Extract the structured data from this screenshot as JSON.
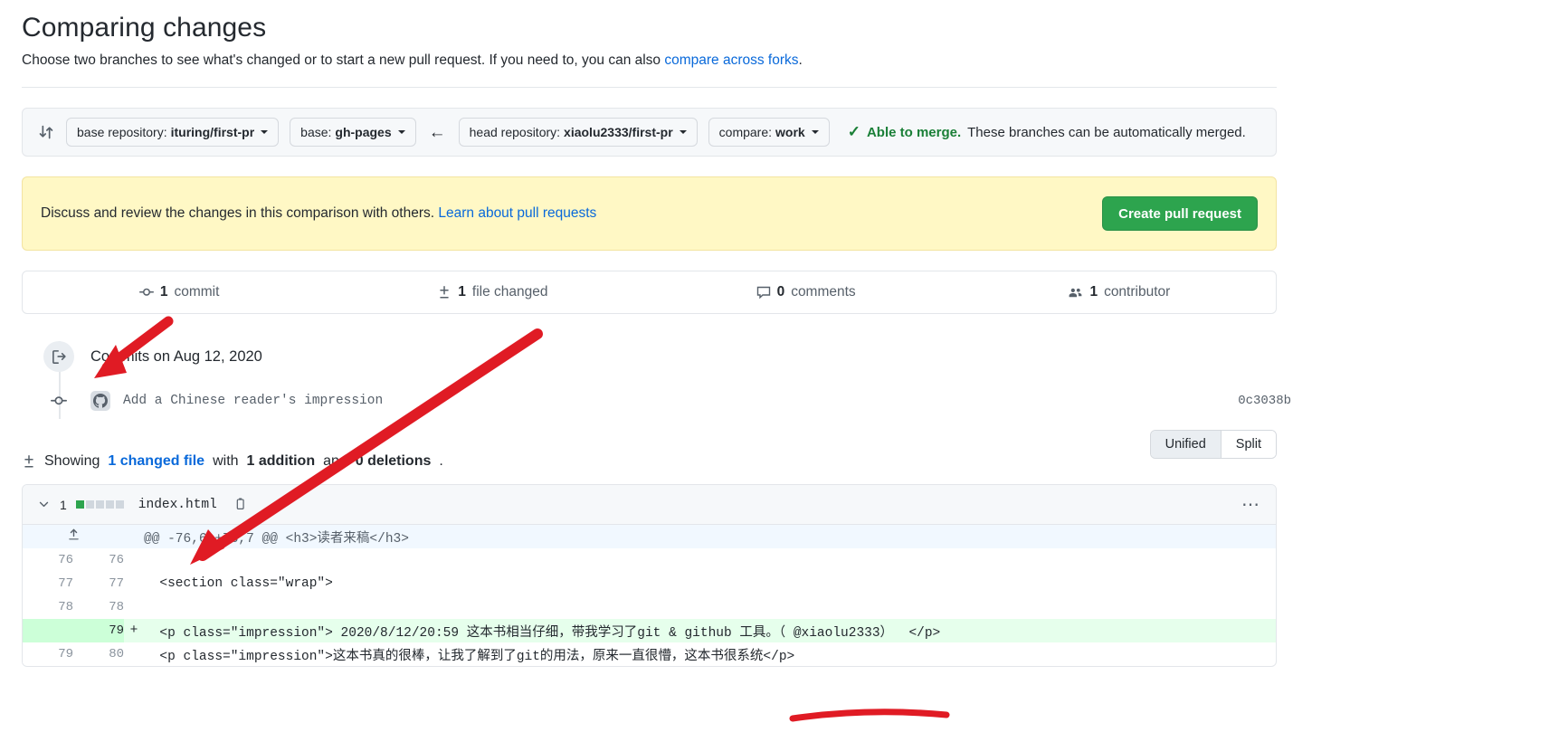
{
  "header": {
    "title": "Comparing changes",
    "subtitle_pre": "Choose two branches to see what's changed or to start a new pull request. If you need to, you can also ",
    "subtitle_link": "compare across forks",
    "subtitle_post": "."
  },
  "branch_bar": {
    "compare_icon": "compare-arrows-icon",
    "base_repository": {
      "label": "base repository:",
      "value": "ituring/first-pr"
    },
    "base": {
      "label": "base:",
      "value": "gh-pages"
    },
    "direction_arrow": "arrow-left-icon",
    "head_repository": {
      "label": "head repository:",
      "value": "xiaolu2333/first-pr"
    },
    "compare": {
      "label": "compare:",
      "value": "work"
    },
    "merge_status": {
      "check_icon": "check-icon",
      "able": "Able to merge.",
      "detail": " These branches can be automatically merged."
    }
  },
  "discuss": {
    "text_pre": "Discuss and review the changes in this comparison with others. ",
    "link": "Learn about pull requests",
    "button": "Create pull request",
    "button_color": "#2da44e",
    "background": "#fff8c5"
  },
  "stats": [
    {
      "icon": "commit-icon",
      "count": "1",
      "label": "commit"
    },
    {
      "icon": "diff-icon",
      "count": "1",
      "label": "file changed"
    },
    {
      "icon": "comment-icon",
      "count": "0",
      "label": "comments"
    },
    {
      "icon": "people-icon",
      "count": "1",
      "label": "contributor"
    }
  ],
  "timeline": {
    "header_icon": "commit-push-icon",
    "header_label": "Commits on Aug 12, 2020",
    "commit": {
      "dot_icon": "commit-dot-icon",
      "avatar_icon": "github-avatar-icon",
      "message": "Add a Chinese reader's impression",
      "sha": "0c3038b"
    }
  },
  "showing": {
    "icon": "diff-icon",
    "pre": "Showing ",
    "changed_file": "1 changed file",
    "mid": " with ",
    "additions": "1 addition",
    "and": " and ",
    "deletions": "0 deletions",
    "end": ".",
    "view_unified": "Unified",
    "view_split": "Split",
    "active_view": "Unified"
  },
  "diff": {
    "chevron_icon": "chevron-down-icon",
    "change_count": "1",
    "blocks": [
      "add",
      "none",
      "none",
      "none",
      "none"
    ],
    "filename": "index.html",
    "copy_icon": "copy-icon",
    "kebab_icon": "kebab-horizontal-icon",
    "expand_icon": "expand-up-icon",
    "hunk_header": "@@ -76,6 +76,7 @@ <h3>读者来稿</h3>",
    "rows": [
      {
        "type": "context",
        "old": "76",
        "new": "76",
        "marker": "",
        "code": ""
      },
      {
        "type": "context",
        "old": "77",
        "new": "77",
        "marker": "",
        "code": "  <section class=\"wrap\">"
      },
      {
        "type": "context",
        "old": "78",
        "new": "78",
        "marker": "",
        "code": ""
      },
      {
        "type": "add",
        "old": "",
        "new": "79",
        "marker": "+",
        "code": "  <p class=\"impression\"> 2020/8/12/20:59 这本书相当仔细，带我学习了git & github 工具。（ @xiaolu2333）  </p>"
      },
      {
        "type": "context",
        "old": "79",
        "new": "80",
        "marker": "",
        "code": "  <p class=\"impression\">这本书真的很棒，让我了解到了git的用法，原来一直很懵，这本书很系统</p>"
      }
    ]
  },
  "annotations": {
    "color": "#e01b24",
    "marks": [
      {
        "name": "arrow-to-commits-header",
        "type": "arrow"
      },
      {
        "name": "arrow-to-file-changed",
        "type": "arrow"
      },
      {
        "name": "underline-author-mention",
        "type": "underline"
      }
    ]
  }
}
